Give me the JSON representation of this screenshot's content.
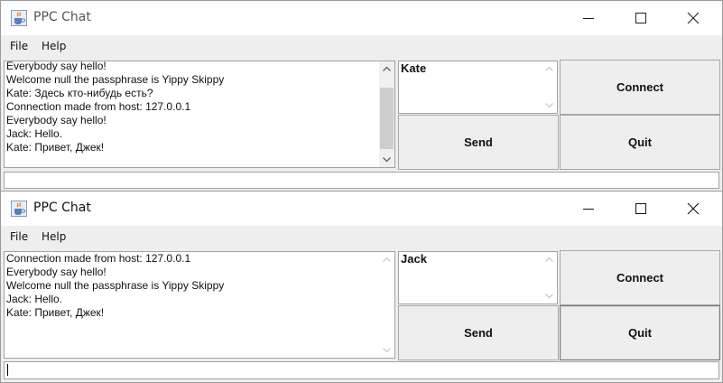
{
  "windows": [
    {
      "title": "PPC Chat",
      "menu": [
        "File",
        "Help"
      ],
      "chat_lines": [
        "Everybody say hello!",
        "Welcome null the passphrase is Yippy Skippy",
        "Kate: Здесь кто-нибудь есть?",
        "Connection made from host: 127.0.0.1",
        "Everybody say hello!",
        "Jack: Hello.",
        "Kate: Привет, Джек!"
      ],
      "chat_scroll_position": 0.3,
      "name_value": "Kate",
      "buttons": {
        "connect": "Connect",
        "send": "Send",
        "quit": "Quit"
      },
      "input_value": ""
    },
    {
      "title": "PPC Chat",
      "menu": [
        "File",
        "Help"
      ],
      "chat_lines": [
        "Connection made from host: 127.0.0.1",
        "Everybody say hello!",
        "Welcome null the passphrase is Yippy Skippy",
        "Jack: Hello.",
        "Kate: Привет, Джек!"
      ],
      "name_value": "Jack",
      "buttons": {
        "connect": "Connect",
        "send": "Send",
        "quit": "Quit"
      },
      "input_value": ""
    }
  ],
  "icons": [
    "java-cup-icon",
    "minimize-icon",
    "maximize-icon",
    "close-icon",
    "scroll-up-arrow-icon",
    "scroll-down-arrow-icon"
  ],
  "colors": {
    "window_bg": "#eeeeee",
    "titlebar_bg": "#ffffff",
    "field_border": "#9ea3a8",
    "scroll_thumb": "#cdcdcd"
  }
}
